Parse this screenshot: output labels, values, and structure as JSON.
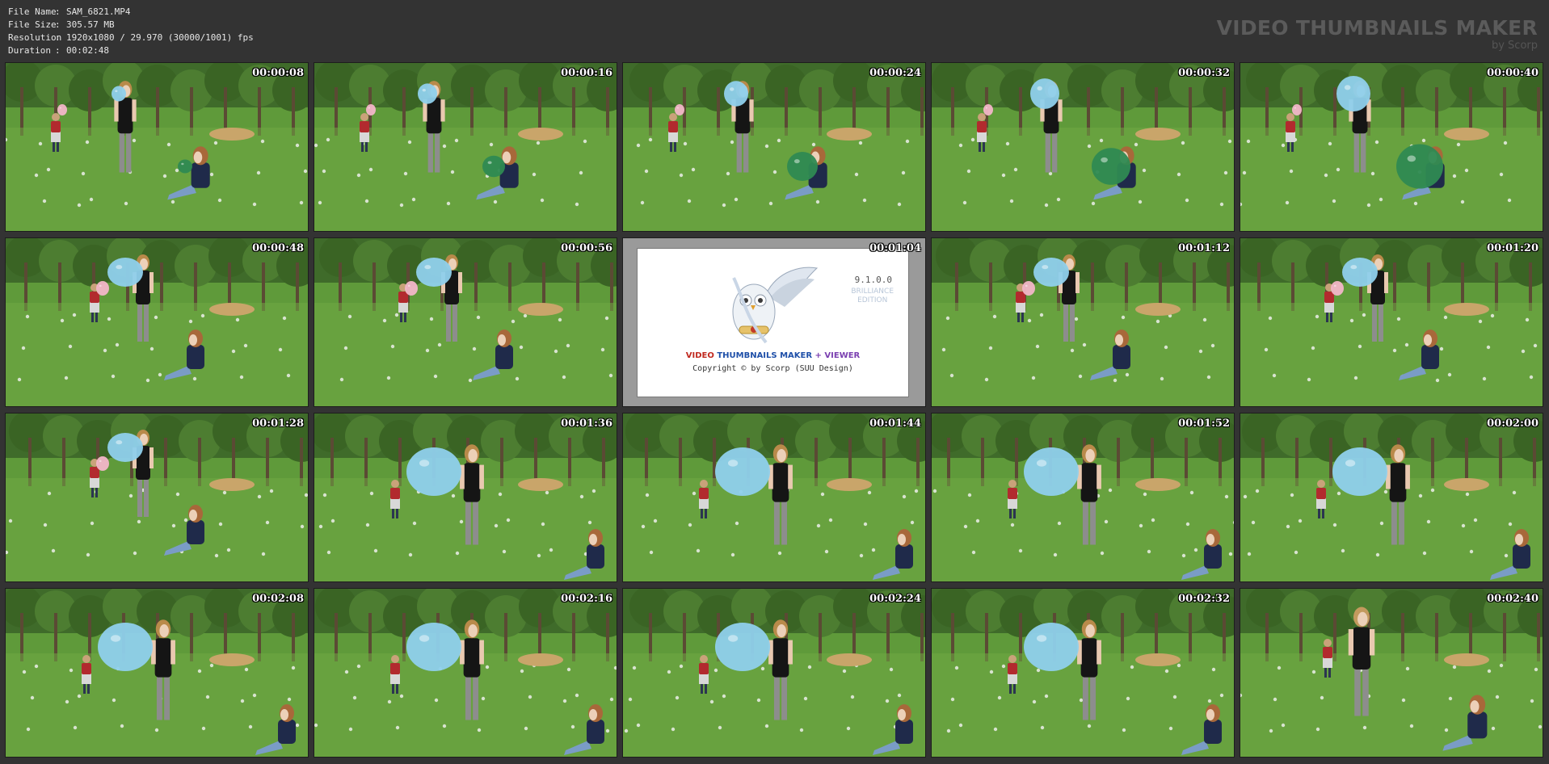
{
  "info": {
    "rows": [
      {
        "label": "File Name",
        "value": "SAM_6821.MP4"
      },
      {
        "label": "File Size",
        "value": "305.57 MB"
      },
      {
        "label": "Resolution",
        "value": "1920x1080 / 29.970 (30000/1001) fps"
      },
      {
        "label": "Duration",
        "value": "00:02:48"
      }
    ],
    "separator": ":"
  },
  "brand": {
    "title": "VIDEO THUMBNAILS MAKER",
    "subtitle": "by Scorp"
  },
  "splash": {
    "version": "9.1.0.0",
    "edition_line1": "BRILLIANCE",
    "edition_line2": "EDITION",
    "title_part1": "VIDEO",
    "title_part2": "THUMBNAILS MAKER",
    "title_part3": "+ VIEWER",
    "copyright": "Copyright © by Scorp (SUU Design)"
  },
  "thumbnails": [
    {
      "time": "00:00:08",
      "scene": "A"
    },
    {
      "time": "00:00:16",
      "scene": "A"
    },
    {
      "time": "00:00:24",
      "scene": "A"
    },
    {
      "time": "00:00:32",
      "scene": "A"
    },
    {
      "time": "00:00:40",
      "scene": "A"
    },
    {
      "time": "00:00:48",
      "scene": "B"
    },
    {
      "time": "00:00:56",
      "scene": "B"
    },
    {
      "time": "00:01:04",
      "scene": "splash"
    },
    {
      "time": "00:01:12",
      "scene": "B"
    },
    {
      "time": "00:01:20",
      "scene": "B"
    },
    {
      "time": "00:01:28",
      "scene": "B"
    },
    {
      "time": "00:01:36",
      "scene": "C"
    },
    {
      "time": "00:01:44",
      "scene": "C"
    },
    {
      "time": "00:01:52",
      "scene": "C"
    },
    {
      "time": "00:02:00",
      "scene": "C"
    },
    {
      "time": "00:02:08",
      "scene": "C"
    },
    {
      "time": "00:02:16",
      "scene": "C"
    },
    {
      "time": "00:02:24",
      "scene": "C"
    },
    {
      "time": "00:02:32",
      "scene": "C"
    },
    {
      "time": "00:02:40",
      "scene": "D"
    }
  ],
  "colors": {
    "background": "#333333",
    "balloon_blue": "#8fd0ec",
    "balloon_green": "#2f8a52",
    "balloon_pink": "#f2b6c8",
    "grass": "#5f9a3a"
  }
}
